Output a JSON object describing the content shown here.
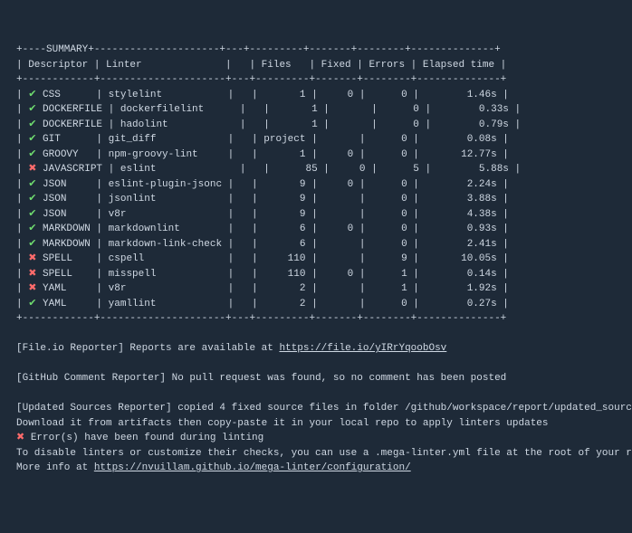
{
  "header": {
    "title": "SUMMARY",
    "columns": [
      "Descriptor",
      "Linter",
      "",
      "Files",
      "Fixed",
      "Errors",
      "Elapsed time"
    ]
  },
  "rows": [
    {
      "status": "ok",
      "descriptor": "CSS",
      "linter": "stylelint",
      "files": "1",
      "fixed": "0",
      "errors": "0",
      "elapsed": "1.46s"
    },
    {
      "status": "ok",
      "descriptor": "DOCKERFILE",
      "linter": "dockerfilelint",
      "files": "1",
      "fixed": "",
      "errors": "0",
      "elapsed": "0.33s"
    },
    {
      "status": "ok",
      "descriptor": "DOCKERFILE",
      "linter": "hadolint",
      "files": "1",
      "fixed": "",
      "errors": "0",
      "elapsed": "0.79s"
    },
    {
      "status": "ok",
      "descriptor": "GIT",
      "linter": "git_diff",
      "files": "project",
      "fixed": "",
      "errors": "0",
      "elapsed": "0.08s"
    },
    {
      "status": "ok",
      "descriptor": "GROOVY",
      "linter": "npm-groovy-lint",
      "files": "1",
      "fixed": "0",
      "errors": "0",
      "elapsed": "12.77s"
    },
    {
      "status": "fail",
      "descriptor": "JAVASCRIPT",
      "linter": "eslint",
      "files": "85",
      "fixed": "0",
      "errors": "5",
      "elapsed": "5.88s"
    },
    {
      "status": "ok",
      "descriptor": "JSON",
      "linter": "eslint-plugin-jsonc",
      "files": "9",
      "fixed": "0",
      "errors": "0",
      "elapsed": "2.24s"
    },
    {
      "status": "ok",
      "descriptor": "JSON",
      "linter": "jsonlint",
      "files": "9",
      "fixed": "",
      "errors": "0",
      "elapsed": "3.88s"
    },
    {
      "status": "ok",
      "descriptor": "JSON",
      "linter": "v8r",
      "files": "9",
      "fixed": "",
      "errors": "0",
      "elapsed": "4.38s"
    },
    {
      "status": "ok",
      "descriptor": "MARKDOWN",
      "linter": "markdownlint",
      "files": "6",
      "fixed": "0",
      "errors": "0",
      "elapsed": "0.93s"
    },
    {
      "status": "ok",
      "descriptor": "MARKDOWN",
      "linter": "markdown-link-check",
      "files": "6",
      "fixed": "",
      "errors": "0",
      "elapsed": "2.41s"
    },
    {
      "status": "fail",
      "descriptor": "SPELL",
      "linter": "cspell",
      "files": "110",
      "fixed": "",
      "errors": "9",
      "elapsed": "10.05s"
    },
    {
      "status": "fail",
      "descriptor": "SPELL",
      "linter": "misspell",
      "files": "110",
      "fixed": "0",
      "errors": "1",
      "elapsed": "0.14s"
    },
    {
      "status": "fail",
      "descriptor": "YAML",
      "linter": "v8r",
      "files": "2",
      "fixed": "",
      "errors": "1",
      "elapsed": "1.92s"
    },
    {
      "status": "ok",
      "descriptor": "YAML",
      "linter": "yamllint",
      "files": "2",
      "fixed": "",
      "errors": "0",
      "elapsed": "0.27s"
    }
  ],
  "footer": {
    "fileio_prefix": "[File.io Reporter] Reports are available at ",
    "fileio_url": "https://file.io/yIRrYqoobOsv",
    "github_comment": "[GitHub Comment Reporter] No pull request was found, so no comment has been posted",
    "updated_sources": "[Updated Sources Reporter] copied 4 fixed source files in folder /github/workspace/report/updated_sources.",
    "download_hint": "Download it from artifacts then copy-paste it in your local repo to apply linters updates",
    "error_line": " Error(s) have been found during linting",
    "disable_hint": "To disable linters or customize their checks, you can use a .mega-linter.yml file at the root of your repository",
    "more_info_prefix": "More info at ",
    "more_info_url": "https://nvuillam.github.io/mega-linter/configuration/"
  },
  "icons": {
    "ok": "✔",
    "fail": "✖"
  }
}
